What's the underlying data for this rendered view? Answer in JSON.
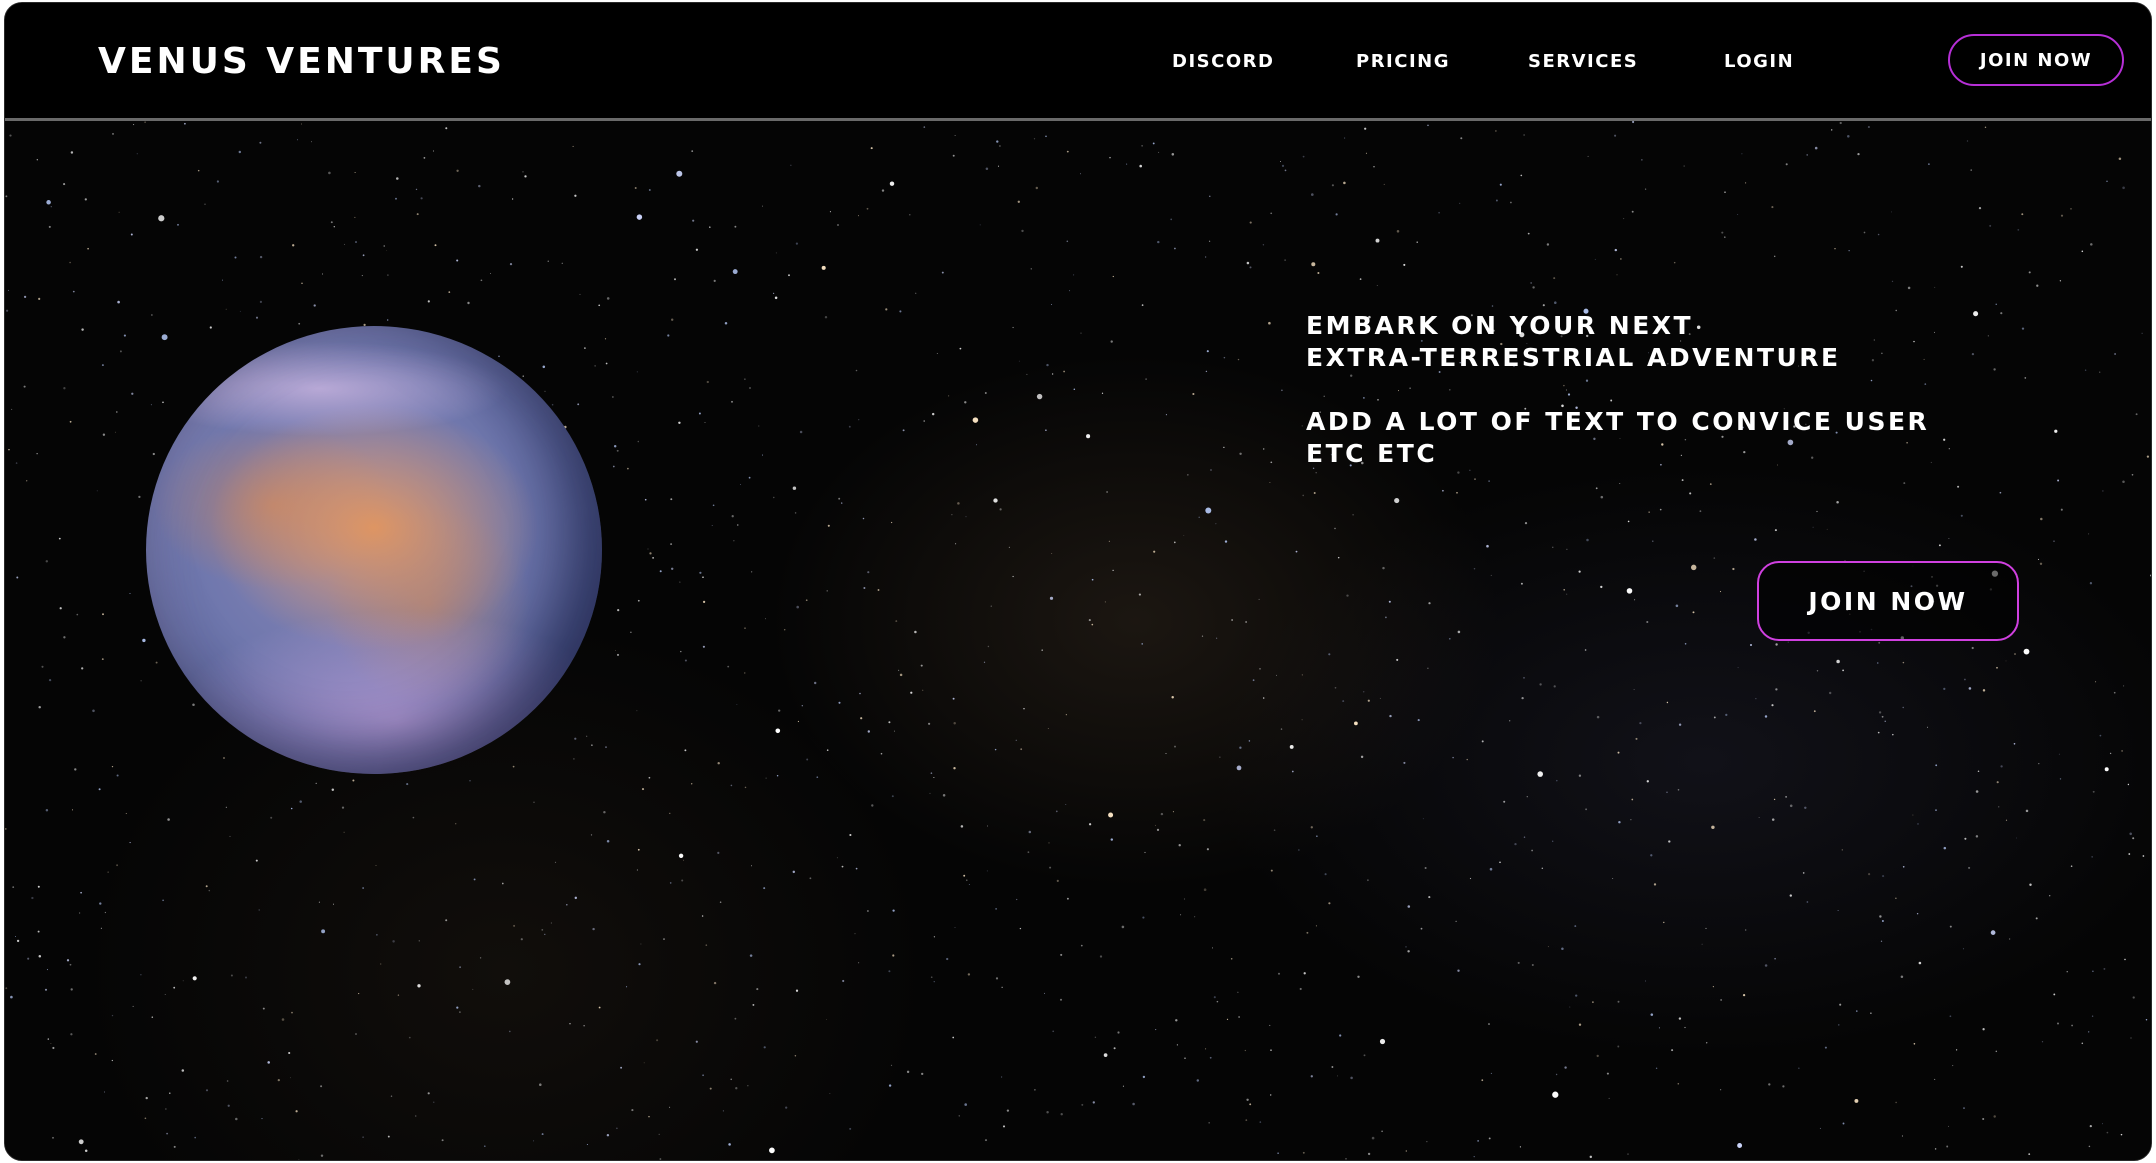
{
  "colors": {
    "background": "#000000",
    "text": "#ffffff",
    "accent_border": "#c23bd8",
    "divider": "#6a6a6a"
  },
  "header": {
    "brand": "VENUS VENTURES",
    "nav": [
      {
        "label": "DISCORD"
      },
      {
        "label": "PRICING"
      },
      {
        "label": "SERVICES"
      },
      {
        "label": "LOGIN"
      }
    ],
    "cta_label": "JOIN NOW"
  },
  "hero": {
    "planet_image": "venus-planet",
    "headline_line1": "EMBARK ON YOUR NEXT",
    "headline_line2": "EXTRA-TERRESTRIAL ADVENTURE",
    "body_line1": "ADD A LOT OF TEXT TO CONVICE USER",
    "body_line2": "ETC ETC",
    "cta_label": "JOIN NOW",
    "background_image": "starfield"
  }
}
